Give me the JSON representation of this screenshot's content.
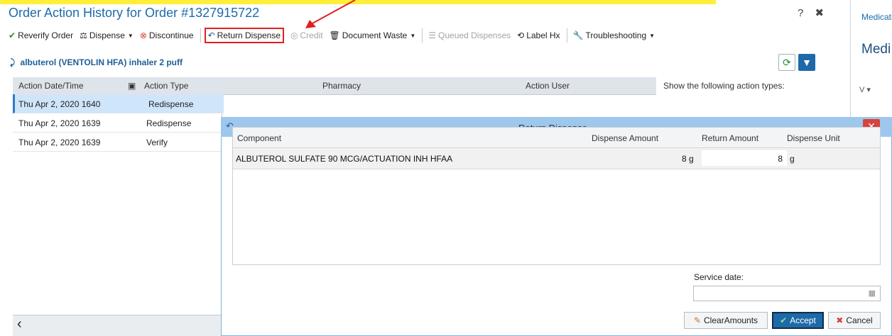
{
  "window": {
    "title": "Order Action History for Order #1327915722",
    "help_icon": "help-circle-icon",
    "close_icon": "close-icon"
  },
  "toolbar": {
    "reverify_label": "Reverify Order",
    "dispense_label": "Dispense",
    "discontinue_label": "Discontinue",
    "return_dispense_label": "Return Dispense",
    "credit_label": "Credit",
    "document_waste_label": "Document Waste",
    "queued_dispenses_label": "Queued Dispenses",
    "label_hx_label": "Label Hx",
    "troubleshooting_label": "Troubleshooting"
  },
  "order": {
    "medication": "albuterol (VENTOLIN HFA) inhaler 2 puff"
  },
  "grid": {
    "headers": [
      "Action Date/Time",
      "Action Type",
      "Pharmacy",
      "Action User"
    ],
    "rows": [
      {
        "datetime": "Thu Apr 2, 2020 1640",
        "type": "Redispense",
        "selected": true
      },
      {
        "datetime": "Thu Apr 2, 2020 1639",
        "type": "Redispense",
        "selected": false
      },
      {
        "datetime": "Thu Apr 2, 2020 1639",
        "type": "Verify",
        "selected": false
      }
    ]
  },
  "filter_panel": {
    "title": "Show the following action types:"
  },
  "right_panel": {
    "tab_label": "Medication",
    "heading": "Medi",
    "column_label": "V ▾"
  },
  "modal": {
    "title": "Return Dispense",
    "table_headers": {
      "component": "Component",
      "dispense_amount": "Dispense Amount",
      "return_amount": "Return Amount",
      "dispense_unit": "Dispense Unit"
    },
    "rows": [
      {
        "component": "ALBUTEROL SULFATE 90 MCG/ACTUATION INH HFAA",
        "dispense_amount": "8 g",
        "return_amount": "8",
        "dispense_unit": "g"
      }
    ],
    "service_date_label": "Service date:",
    "service_date_value": "",
    "buttons": {
      "clear_amounts": "ClearAmounts",
      "accept": "Accept",
      "cancel": "Cancel"
    }
  },
  "colors": {
    "title_blue": "#1e6aa8",
    "highlight_red": "#e02020",
    "modal_header": "#9dc7ec",
    "selected_row": "#cfe5fa"
  }
}
